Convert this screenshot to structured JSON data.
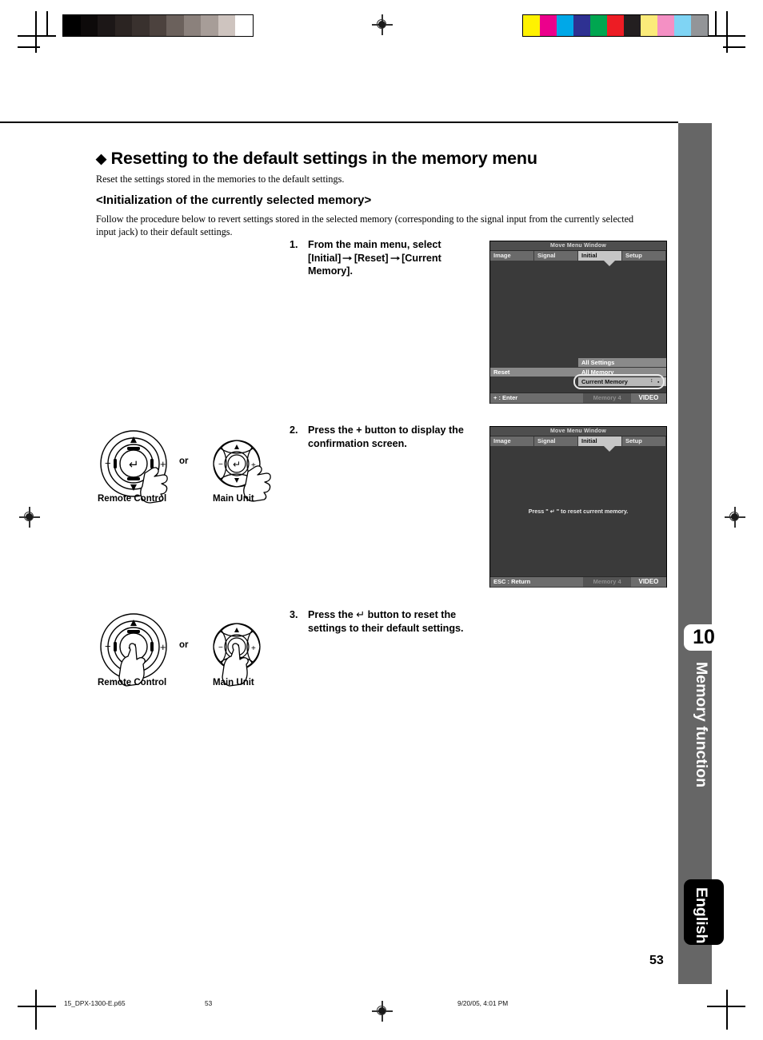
{
  "document": {
    "heading": "Resetting to the default settings in the memory menu",
    "heading_bullet": "◆",
    "lead": "Reset the settings stored in the memories to the default settings.",
    "subheading": "<Initialization of the currently selected memory>",
    "intro": "Follow the procedure below to revert settings stored in the selected memory (corresponding to the signal input from the currently selected input jack) to their default settings.",
    "page_number": "53"
  },
  "steps": [
    {
      "number": "1.",
      "line1_pre": "From the main menu, select",
      "line2_a": "[Initial]",
      "line2_b": "[Reset]",
      "line2_c": "[Current",
      "line3": "Memory].",
      "arrow": "➞"
    },
    {
      "number": "2.",
      "line1": "Press the + button to display the",
      "line2": "confirmation screen."
    },
    {
      "number": "3.",
      "line1_a": "Press the",
      "enter_glyph": "↵",
      "line1_b": "button to reset the",
      "line2": "settings to their default settings."
    }
  ],
  "illustrations": {
    "or_label": "or",
    "remote_label": "Remote Control",
    "main_unit_label": "Main Unit",
    "pad_up": "▲",
    "pad_down": "▼",
    "pad_minus": "−",
    "pad_plus": "+",
    "pad_enter": "↵"
  },
  "osd_screens": [
    {
      "title": "Move Menu Window",
      "tabs": [
        "Image",
        "Signal",
        "Initial",
        "Setup"
      ],
      "selected_tab": "Initial",
      "menu_label": "Reset",
      "items": [
        "All Settings",
        "All Memory",
        "Current Memory"
      ],
      "highlighted_item": "Current Memory",
      "footer_left": "+ : Enter",
      "footer_middle": "Memory 4",
      "footer_right": "VIDEO"
    },
    {
      "title": "Move Menu Window",
      "tabs": [
        "Image",
        "Signal",
        "Initial",
        "Setup"
      ],
      "selected_tab": "Initial",
      "message": "Press \" ↵ \" to reset current memory.",
      "footer_left": "ESC : Return",
      "footer_middle": "Memory 4",
      "footer_right": "VIDEO"
    }
  ],
  "chapter_tab": {
    "number": "10",
    "label": "Memory function"
  },
  "language_tab": {
    "label": "English"
  },
  "print_footer": {
    "filename": "15_DPX-1300-E.p65",
    "page": "53",
    "timestamp": "9/20/05, 4:01 PM"
  },
  "colors": {
    "side_band": "#666666",
    "osd_background": "#3a3a3a",
    "osd_selected_tab": "#c6c6c6",
    "osd_item": "#8a8a8a",
    "osd_item_highlight": "#b9b9b9"
  },
  "color_bar_swatches": [
    "#fff200",
    "#ec008c",
    "#00a8e8",
    "#2e3192",
    "#00a650",
    "#ed1c24",
    "#231f20",
    "#fbeb7a",
    "#f490c4",
    "#7fd4f4",
    "#939598"
  ],
  "gray_bar_swatches": [
    "#000000",
    "#0d0a0a",
    "#1c1717",
    "#2b2422",
    "#39312e",
    "#4c423e",
    "#6b615c",
    "#8b817c",
    "#a79d98",
    "#cec4bf",
    "#ffffff"
  ]
}
